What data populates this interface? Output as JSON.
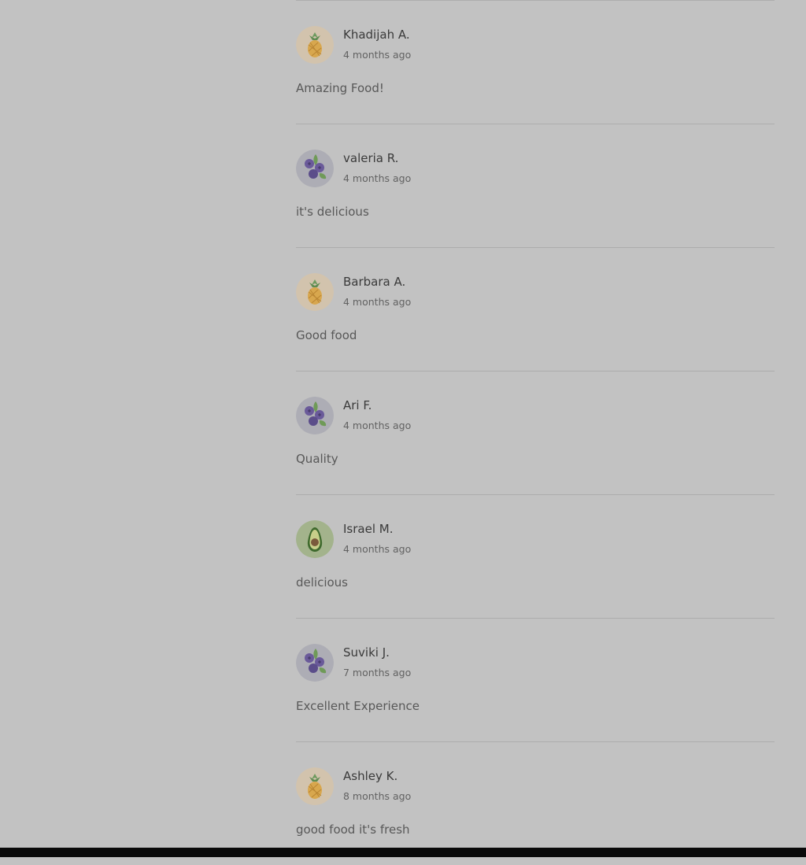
{
  "reviews": [
    {
      "name": "Khadijah A.",
      "time": "4 months ago",
      "text": "Amazing Food!",
      "avatar": "pineapple-icon"
    },
    {
      "name": "valeria R.",
      "time": "4 months ago",
      "text": "it's delicious",
      "avatar": "blueberry-icon"
    },
    {
      "name": "Barbara A.",
      "time": "4 months ago",
      "text": "Good food",
      "avatar": "pineapple-icon"
    },
    {
      "name": "Ari F.",
      "time": "4 months ago",
      "text": "Quality",
      "avatar": "blueberry-icon"
    },
    {
      "name": "Israel M.",
      "time": "4 months ago",
      "text": "delicious",
      "avatar": "avocado-icon"
    },
    {
      "name": "Suviki J.",
      "time": "7 months ago",
      "text": "Excellent Experience",
      "avatar": "blueberry-icon"
    },
    {
      "name": "Ashley K.",
      "time": "8 months ago",
      "text": "good food it's fresh",
      "avatar": "pineapple-icon"
    }
  ],
  "colors": {
    "overlay_background": "#c2c2c2",
    "pineapple_bg": "#d2c3ad",
    "blueberry_bg": "#adadb5",
    "avocado_bg": "#a3b38c"
  }
}
